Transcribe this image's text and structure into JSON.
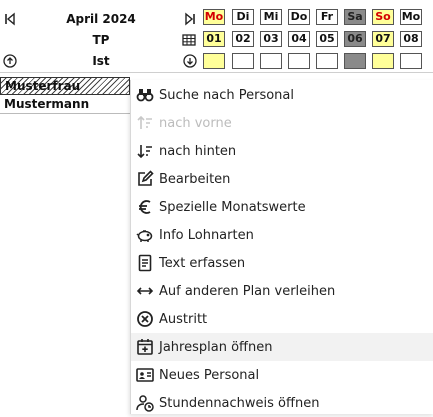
{
  "header": {
    "month_title": "April 2024",
    "plan_label": "TP",
    "mode_label": "Ist",
    "icons": [
      "prev-icon",
      "next-icon",
      "calendar-grid-icon",
      "up-circle-icon",
      "down-circle-icon"
    ]
  },
  "calendar": {
    "weekdays": [
      "Mo",
      "Di",
      "Mi",
      "Do",
      "Fr",
      "Sa",
      "So",
      "Mo"
    ],
    "dates": [
      "01",
      "02",
      "03",
      "04",
      "05",
      "06",
      "07",
      "08"
    ],
    "colors": {
      "yellow": "#ffff99",
      "weekend_gray": "#8a8a8a",
      "holiday_red": "#d40000"
    }
  },
  "people": [
    "Musterfrau",
    "Mustermann"
  ],
  "menu": {
    "items": [
      {
        "label": "Suche nach Personal",
        "icon": "binoculars-icon"
      },
      {
        "label": "nach vorne",
        "icon": "sort-up-icon",
        "disabled": true
      },
      {
        "label": "nach hinten",
        "icon": "sort-down-icon"
      },
      {
        "label": "Bearbeiten",
        "icon": "edit-icon"
      },
      {
        "label": "Spezielle Monatswerte",
        "icon": "euro-icon"
      },
      {
        "label": "Info Lohnarten",
        "icon": "piggy-bank-icon"
      },
      {
        "label": "Text erfassen",
        "icon": "document-icon"
      },
      {
        "label": "Auf anderen Plan verleihen",
        "icon": "swap-arrows-icon"
      },
      {
        "label": "Austritt",
        "icon": "close-circle-icon"
      },
      {
        "label": "Jahresplan öffnen",
        "icon": "calendar-plus-icon"
      },
      {
        "label": "Neues Personal",
        "icon": "id-card-icon"
      },
      {
        "label": "Stundennachweis öffnen",
        "icon": "user-clock-icon"
      }
    ]
  }
}
